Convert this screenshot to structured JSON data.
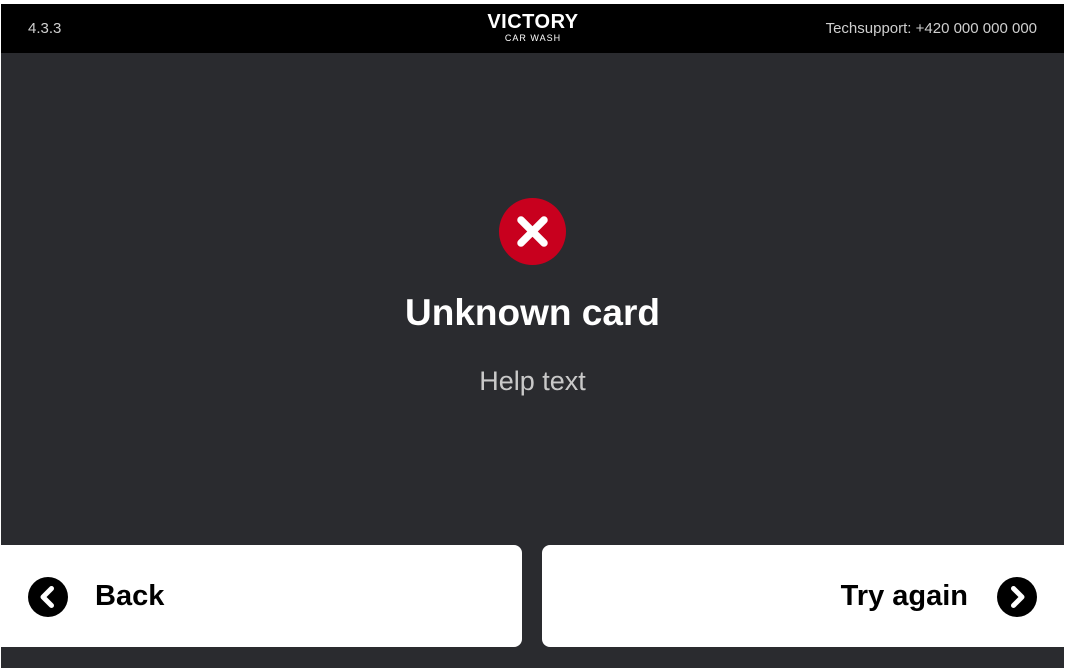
{
  "header": {
    "version": "4.3.3",
    "logo_main": "VICTORY",
    "logo_sub": "CAR WASH",
    "techsupport": "Techsupport: +420 000 000 000"
  },
  "message": {
    "icon": "error-x-icon",
    "title": "Unknown card",
    "help": "Help text"
  },
  "buttons": {
    "back_label": "Back",
    "retry_label": "Try again"
  },
  "colors": {
    "background": "#2a2b2f",
    "topbar": "#000000",
    "error_red": "#c8001e",
    "button_bg": "#ffffff"
  }
}
